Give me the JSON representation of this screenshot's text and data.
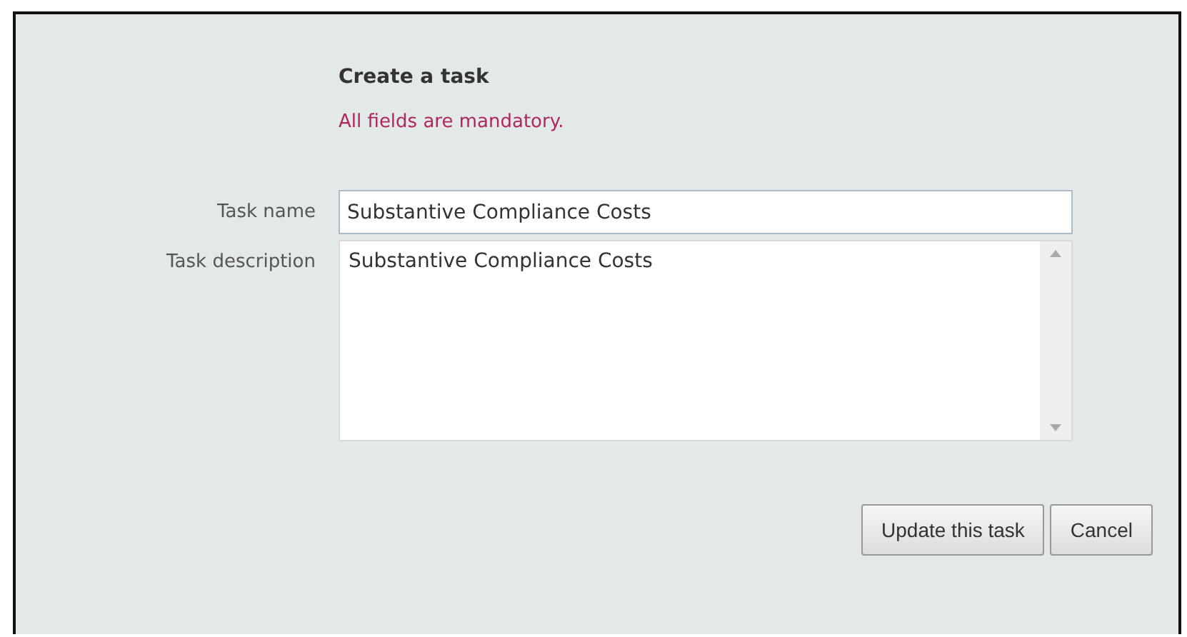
{
  "form": {
    "title": "Create a task",
    "notice": "All fields are mandatory.",
    "fields": [
      {
        "kind": "input",
        "label": "Task name",
        "value": "Substantive Compliance Costs"
      },
      {
        "kind": "textarea",
        "label": "Task description",
        "value": "Substantive Compliance Costs"
      }
    ],
    "buttons": [
      "Update this task",
      "Cancel"
    ]
  }
}
